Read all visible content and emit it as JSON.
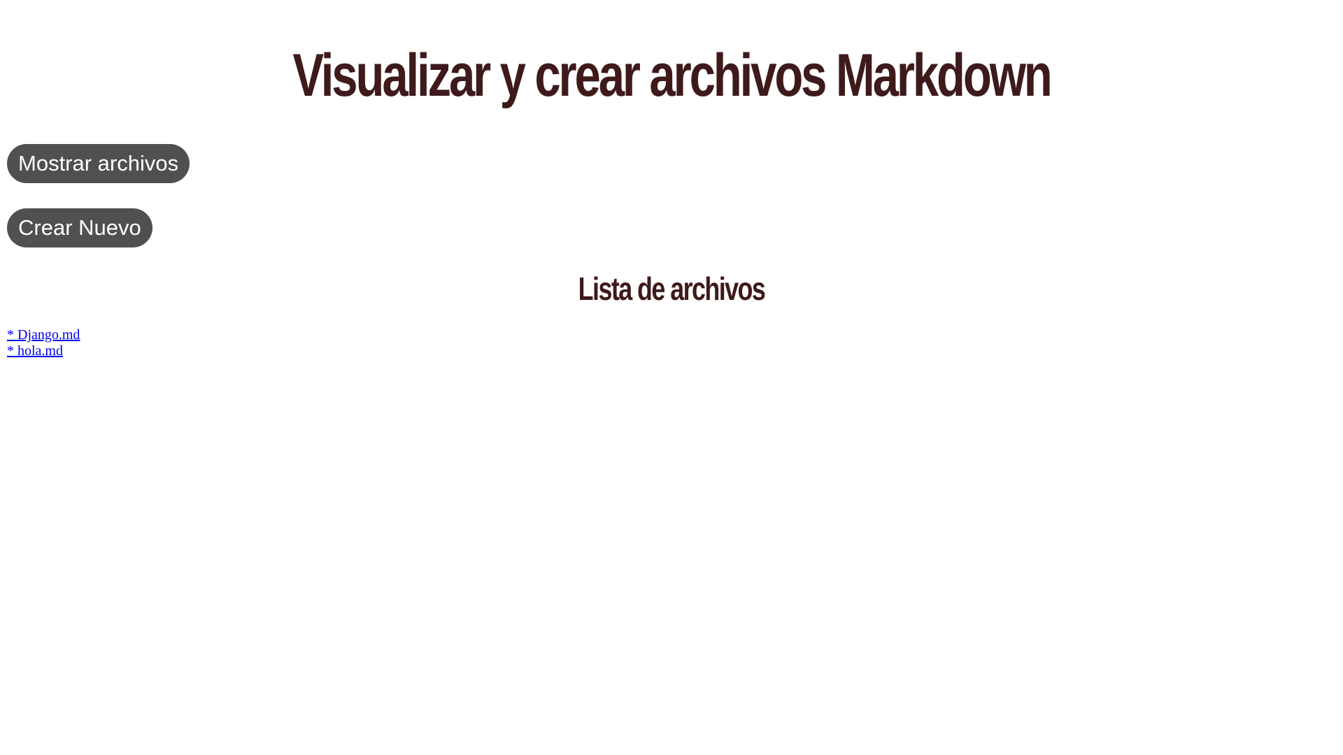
{
  "header": {
    "title": "Visualizar y crear archivos Markdown"
  },
  "actions": {
    "show_files_label": "Mostrar archivos",
    "create_new_label": "Crear Nuevo"
  },
  "file_list": {
    "heading": "Lista de archivos",
    "items": [
      {
        "label": "* Django.md"
      },
      {
        "label": "* hola.md"
      }
    ]
  },
  "colors": {
    "title": "#3f1a1a",
    "button_bg": "#505050",
    "button_text": "#ffffff",
    "link": "#0000ee"
  }
}
